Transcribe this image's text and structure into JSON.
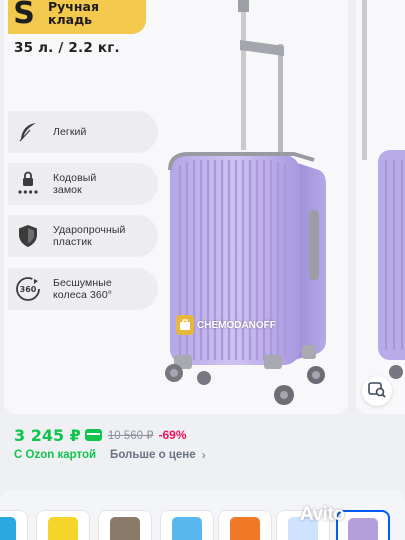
{
  "badge": {
    "size_letter": "S",
    "size_text_line1": "Ручная",
    "size_text_line2": "кладь"
  },
  "capacity": "35 л. / 2.2 кг.",
  "features": [
    {
      "icon": "feather-icon",
      "label_line1": "Легкий",
      "label_line2": ""
    },
    {
      "icon": "lock-icon",
      "label_line1": "Кодовый",
      "label_line2": "замок"
    },
    {
      "icon": "shield-icon",
      "label_line1": "Ударопрочный",
      "label_line2": "пластик"
    },
    {
      "icon": "rotate-360-icon",
      "label_line1": "Бесшумные",
      "label_line2": "колеса 360°"
    }
  ],
  "watermark": "CHEMODANOFF",
  "price": {
    "current": "3 245 ₽",
    "old": "10 560 ₽",
    "discount": "-69%",
    "ozon_card": "С Ozon картой",
    "more": "Больше о цене",
    "chevron": "›"
  },
  "colors": {
    "accent_green": "#10c44c",
    "discount_red": "#f91155",
    "suitcase_lilac": "#c4b6ec",
    "badge_yellow": "#f2c94c"
  },
  "variants": [
    {
      "color": "#29a9e0"
    },
    {
      "color": "#f6d52a"
    },
    {
      "color": "#8a7a68"
    },
    {
      "color": "#5ab8f0"
    },
    {
      "color": "#f07a28"
    },
    {
      "color": "#cfe3ff"
    },
    {
      "color": "#b39ddb"
    }
  ],
  "avito_watermark": "Avito"
}
